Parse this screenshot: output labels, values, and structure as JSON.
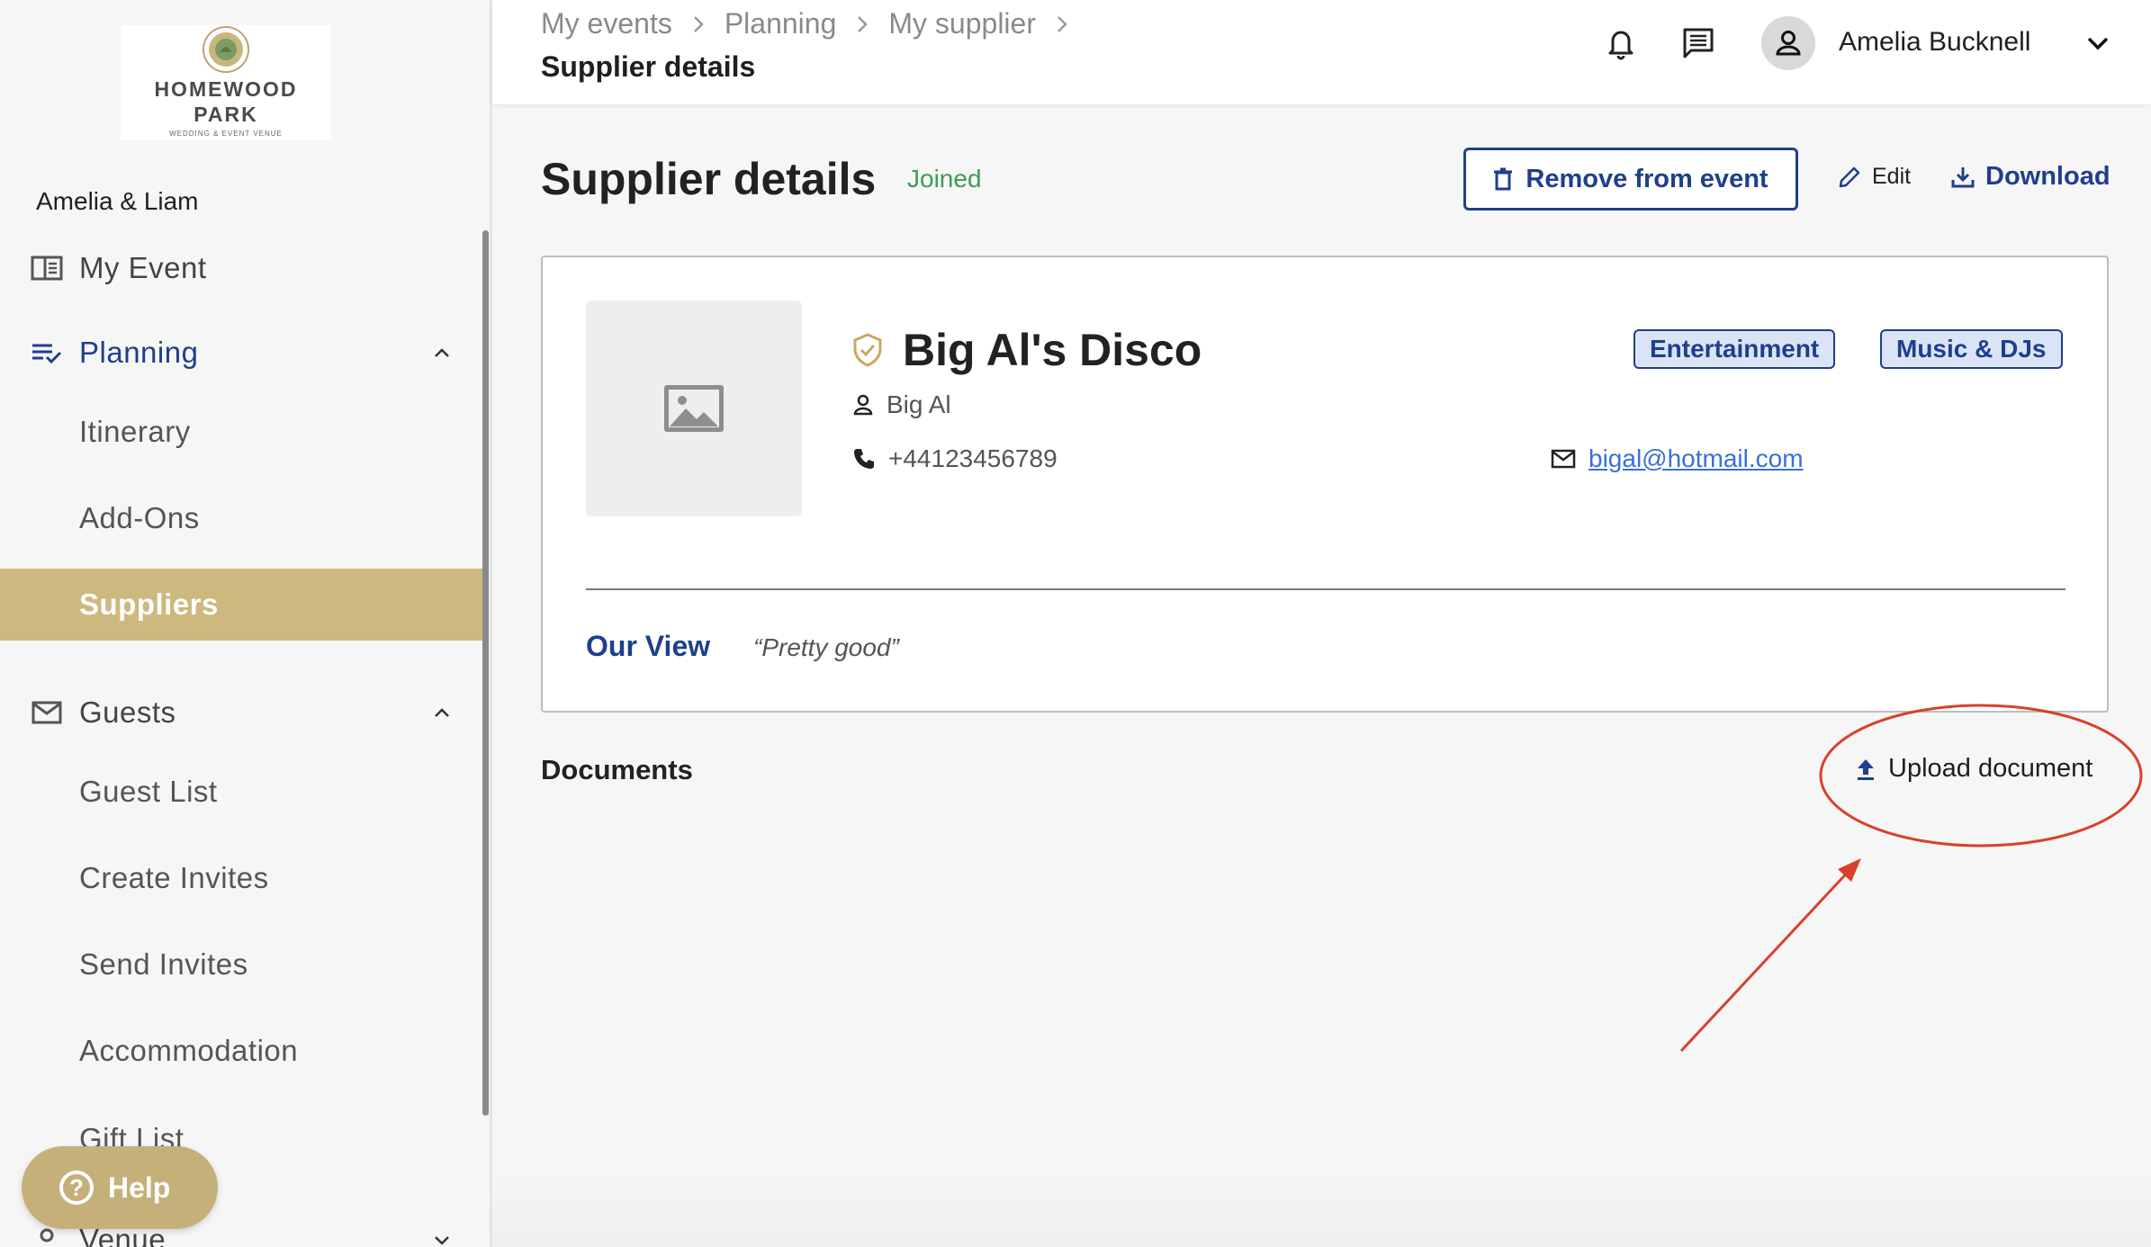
{
  "logo": {
    "line1": "HOMEWOOD",
    "line2": "PARK",
    "tagline": "WEDDING & EVENT VENUE"
  },
  "sidebar": {
    "couple": "Amelia & Liam",
    "items": [
      {
        "label": "My Event",
        "icon": "book-open-icon"
      },
      {
        "label": "Planning",
        "icon": "checklist-icon",
        "expanded": true
      },
      {
        "label": "Itinerary"
      },
      {
        "label": "Add-Ons"
      },
      {
        "label": "Suppliers",
        "active": true
      },
      {
        "label": "Guests",
        "icon": "mail-icon",
        "expanded": true
      },
      {
        "label": "Guest List"
      },
      {
        "label": "Create Invites"
      },
      {
        "label": "Send Invites"
      },
      {
        "label": "Accommodation"
      },
      {
        "label": "Gift List"
      },
      {
        "label": "Venue",
        "icon": "location-pin-icon",
        "expanded": false
      }
    ],
    "help_label": "Help"
  },
  "header": {
    "breadcrumbs": [
      "My events",
      "Planning",
      "My supplier"
    ],
    "current": "Supplier details",
    "user_name": "Amelia Bucknell"
  },
  "main": {
    "title": "Supplier details",
    "status": "Joined",
    "remove_label": "Remove from event",
    "edit_label": "Edit",
    "download_label": "Download",
    "supplier": {
      "name": "Big Al's Disco",
      "contact_person": "Big Al",
      "phone": "+44123456789",
      "email": "bigal@hotmail.com",
      "tags": [
        "Entertainment",
        "Music & DJs"
      ]
    },
    "our_view_label": "Our View",
    "our_view_text": "“Pretty good”",
    "documents_title": "Documents",
    "upload_label": "Upload document"
  },
  "colors": {
    "accent_gold": "#cdb87f",
    "primary_blue": "#1f3f8c",
    "status_green": "#3d9a57",
    "annotation_red": "#d9402b"
  }
}
